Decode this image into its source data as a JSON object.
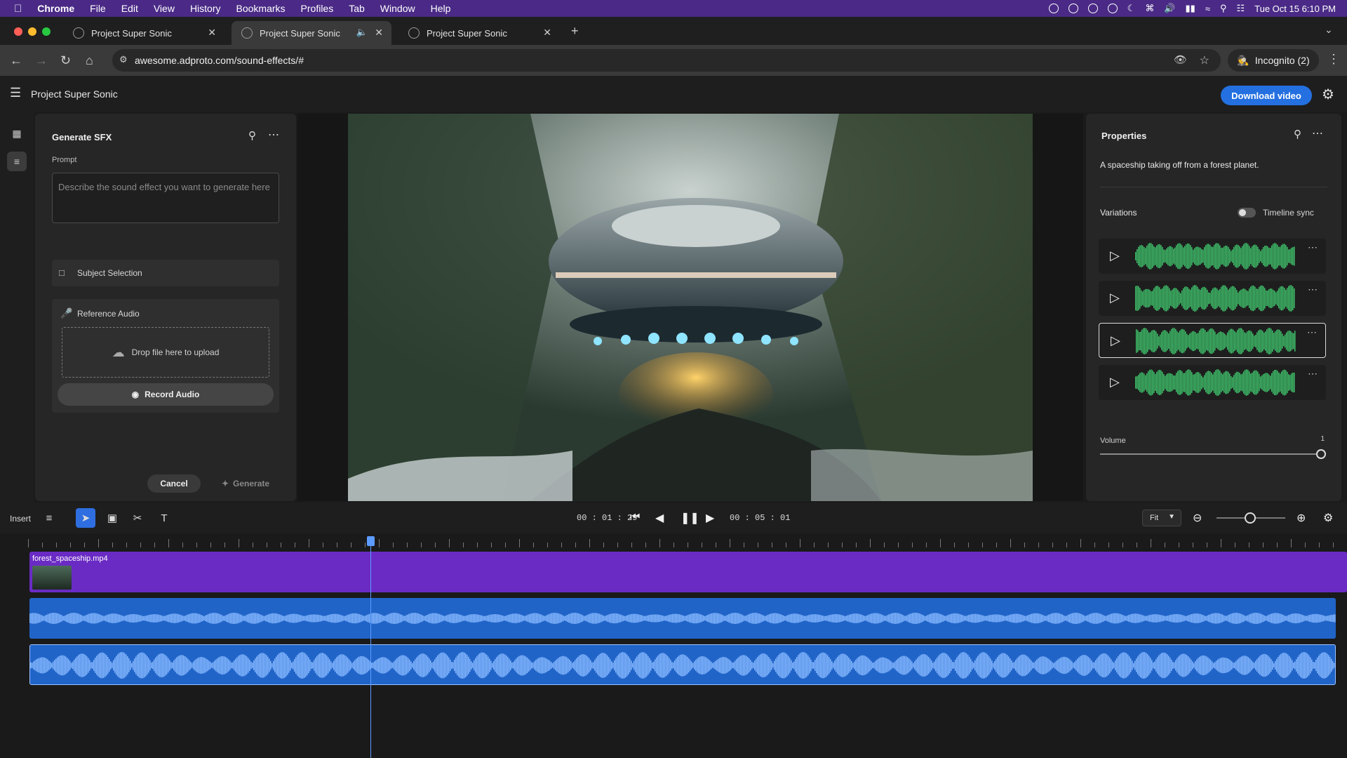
{
  "menubar": {
    "app": "Chrome",
    "items": [
      "File",
      "Edit",
      "View",
      "History",
      "Bookmarks",
      "Profiles",
      "Tab",
      "Window",
      "Help"
    ],
    "clock": "Tue Oct 15  6:10 PM"
  },
  "tabs": [
    {
      "title": "Project Super Sonic"
    },
    {
      "title": "Project Super Sonic"
    },
    {
      "title": "Project Super Sonic"
    }
  ],
  "browser": {
    "url": "awesome.adproto.com/sound-effects/#",
    "incognito": "Incognito (2)"
  },
  "app": {
    "project_title": "Project Super Sonic",
    "download_label": "Download video"
  },
  "sfx_panel": {
    "title": "Generate SFX",
    "prompt_label": "Prompt",
    "prompt_placeholder": "Describe the sound effect you want to generate here",
    "subject_selection": "Subject Selection",
    "reference_audio": "Reference Audio",
    "drop_text": "Drop file here to upload",
    "record_label": "Record Audio",
    "cancel_label": "Cancel",
    "generate_label": "Generate"
  },
  "properties": {
    "title": "Properties",
    "description": "A spaceship taking off from a forest planet.",
    "variations_label": "Variations",
    "timeline_sync_label": "Timeline sync",
    "timeline_sync_on": false,
    "variation_count": 4,
    "selected_variation": 3,
    "volume_label": "Volume",
    "volume_value": "1"
  },
  "toolbar": {
    "insert_label": "Insert",
    "current_time": "00 : 01 : 29",
    "total_time": "00 : 05 : 01",
    "fit_label": "Fit"
  },
  "timeline": {
    "video_clip_name": "forest_spaceship.mp4",
    "playhead_time": "00 : 01 : 29"
  },
  "colors": {
    "menubar": "#4a2a86",
    "accent": "#2470e0",
    "video_clip": "#6a2bc4",
    "audio_clip": "#2164c8",
    "variation_wave": "#3fc06a"
  }
}
